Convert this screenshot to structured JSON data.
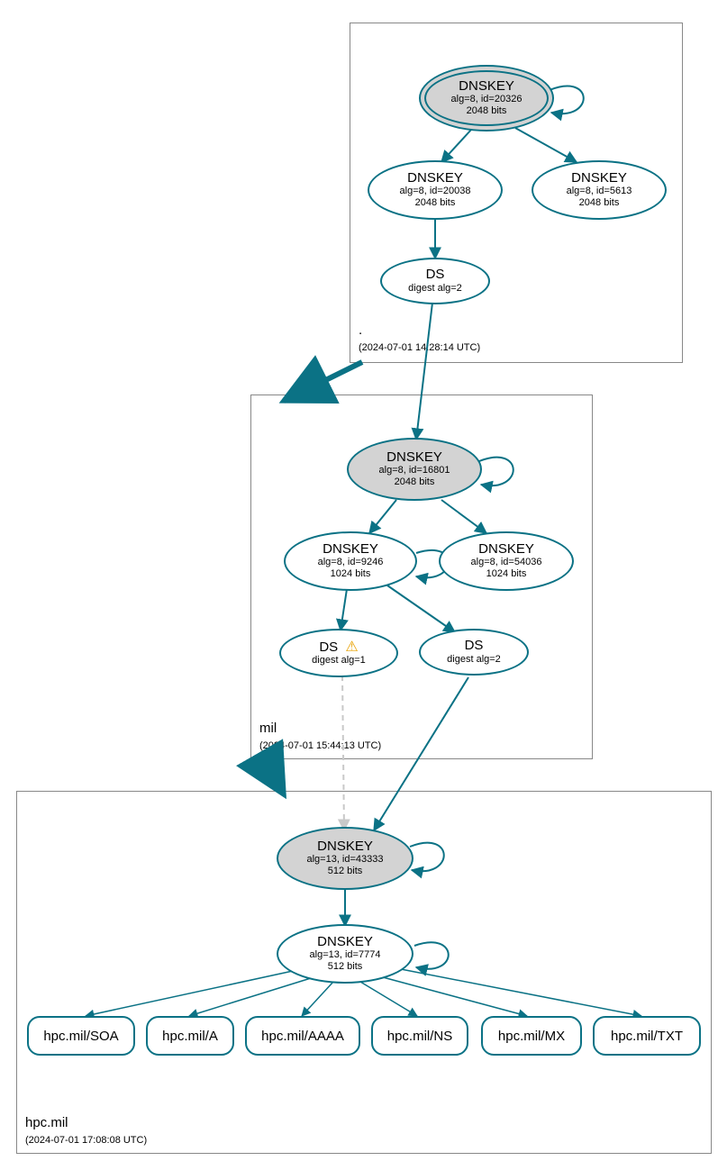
{
  "diagram_type": "DNSSEC delegation / chain of trust",
  "colors": {
    "stroke": "#0b7285",
    "ksk_fill": "#d3d3d3",
    "warn": "#e8a100"
  },
  "zones": {
    "root": {
      "name": ".",
      "timestamp": "(2024-07-01 14:28:14 UTC)"
    },
    "mil": {
      "name": "mil",
      "timestamp": "(2024-07-01 15:44:13 UTC)"
    },
    "hpcmil": {
      "name": "hpc.mil",
      "timestamp": "(2024-07-01 17:08:08 UTC)"
    }
  },
  "nodes": {
    "root_ksk": {
      "title": "DNSKEY",
      "line1": "alg=8, id=20326",
      "line2": "2048 bits"
    },
    "root_zsk1": {
      "title": "DNSKEY",
      "line1": "alg=8, id=20038",
      "line2": "2048 bits"
    },
    "root_zsk2": {
      "title": "DNSKEY",
      "line1": "alg=8, id=5613",
      "line2": "2048 bits"
    },
    "root_ds": {
      "title": "DS",
      "line1": "digest alg=2"
    },
    "mil_ksk": {
      "title": "DNSKEY",
      "line1": "alg=8, id=16801",
      "line2": "2048 bits"
    },
    "mil_zsk1": {
      "title": "DNSKEY",
      "line1": "alg=8, id=9246",
      "line2": "1024 bits"
    },
    "mil_zsk2": {
      "title": "DNSKEY",
      "line1": "alg=8, id=54036",
      "line2": "1024 bits"
    },
    "mil_ds1": {
      "title": "DS",
      "line1": "digest alg=1",
      "warn": true
    },
    "mil_ds2": {
      "title": "DS",
      "line1": "digest alg=2"
    },
    "hpc_ksk": {
      "title": "DNSKEY",
      "line1": "alg=13, id=43333",
      "line2": "512 bits"
    },
    "hpc_zsk": {
      "title": "DNSKEY",
      "line1": "alg=13, id=7774",
      "line2": "512 bits"
    }
  },
  "rrsets": {
    "soa": {
      "label": "hpc.mil/SOA"
    },
    "a": {
      "label": "hpc.mil/A"
    },
    "aaaa": {
      "label": "hpc.mil/AAAA"
    },
    "ns": {
      "label": "hpc.mil/NS"
    },
    "mx": {
      "label": "hpc.mil/MX"
    },
    "txt": {
      "label": "hpc.mil/TXT"
    }
  },
  "chart_data": {
    "type": "graph",
    "description": "DNSSEC authentication chain from root zone through mil to hpc.mil",
    "zones": [
      {
        "name": ".",
        "timestamp_utc": "2024-07-01 14:28:14"
      },
      {
        "name": "mil",
        "timestamp_utc": "2024-07-01 15:44:13"
      },
      {
        "name": "hpc.mil",
        "timestamp_utc": "2024-07-01 17:08:08"
      }
    ],
    "nodes": [
      {
        "id": "root_ksk",
        "zone": ".",
        "type": "DNSKEY",
        "alg": 8,
        "keyid": 20326,
        "bits": 2048,
        "role": "KSK",
        "trust_anchor": true
      },
      {
        "id": "root_zsk1",
        "zone": ".",
        "type": "DNSKEY",
        "alg": 8,
        "keyid": 20038,
        "bits": 2048,
        "role": "ZSK"
      },
      {
        "id": "root_zsk2",
        "zone": ".",
        "type": "DNSKEY",
        "alg": 8,
        "keyid": 5613,
        "bits": 2048,
        "role": "ZSK"
      },
      {
        "id": "root_ds",
        "zone": ".",
        "type": "DS",
        "digest_alg": 2,
        "target_zone": "mil"
      },
      {
        "id": "mil_ksk",
        "zone": "mil",
        "type": "DNSKEY",
        "alg": 8,
        "keyid": 16801,
        "bits": 2048,
        "role": "KSK"
      },
      {
        "id": "mil_zsk1",
        "zone": "mil",
        "type": "DNSKEY",
        "alg": 8,
        "keyid": 9246,
        "bits": 1024,
        "role": "ZSK"
      },
      {
        "id": "mil_zsk2",
        "zone": "mil",
        "type": "DNSKEY",
        "alg": 8,
        "keyid": 54036,
        "bits": 1024,
        "role": "ZSK"
      },
      {
        "id": "mil_ds1",
        "zone": "mil",
        "type": "DS",
        "digest_alg": 1,
        "target_zone": "hpc.mil",
        "warning": true
      },
      {
        "id": "mil_ds2",
        "zone": "mil",
        "type": "DS",
        "digest_alg": 2,
        "target_zone": "hpc.mil"
      },
      {
        "id": "hpc_ksk",
        "zone": "hpc.mil",
        "type": "DNSKEY",
        "alg": 13,
        "keyid": 43333,
        "bits": 512,
        "role": "KSK"
      },
      {
        "id": "hpc_zsk",
        "zone": "hpc.mil",
        "type": "DNSKEY",
        "alg": 13,
        "keyid": 7774,
        "bits": 512,
        "role": "ZSK"
      },
      {
        "id": "rr_soa",
        "zone": "hpc.mil",
        "type": "RRset",
        "name": "hpc.mil",
        "rrtype": "SOA"
      },
      {
        "id": "rr_a",
        "zone": "hpc.mil",
        "type": "RRset",
        "name": "hpc.mil",
        "rrtype": "A"
      },
      {
        "id": "rr_aaaa",
        "zone": "hpc.mil",
        "type": "RRset",
        "name": "hpc.mil",
        "rrtype": "AAAA"
      },
      {
        "id": "rr_ns",
        "zone": "hpc.mil",
        "type": "RRset",
        "name": "hpc.mil",
        "rrtype": "NS"
      },
      {
        "id": "rr_mx",
        "zone": "hpc.mil",
        "type": "RRset",
        "name": "hpc.mil",
        "rrtype": "MX"
      },
      {
        "id": "rr_txt",
        "zone": "hpc.mil",
        "type": "RRset",
        "name": "hpc.mil",
        "rrtype": "TXT"
      }
    ],
    "edges": [
      {
        "from": "root_ksk",
        "to": "root_ksk",
        "kind": "self-sign"
      },
      {
        "from": "root_ksk",
        "to": "root_zsk1",
        "kind": "signs"
      },
      {
        "from": "root_ksk",
        "to": "root_zsk2",
        "kind": "signs"
      },
      {
        "from": "root_zsk1",
        "to": "root_ds",
        "kind": "signs"
      },
      {
        "from": "root_ds",
        "to": "mil_ksk",
        "kind": "delegates"
      },
      {
        "from": "mil_ksk",
        "to": "mil_ksk",
        "kind": "self-sign"
      },
      {
        "from": "mil_ksk",
        "to": "mil_zsk1",
        "kind": "signs"
      },
      {
        "from": "mil_ksk",
        "to": "mil_zsk2",
        "kind": "signs"
      },
      {
        "from": "mil_zsk1",
        "to": "mil_zsk1",
        "kind": "self-sign"
      },
      {
        "from": "mil_zsk1",
        "to": "mil_ds1",
        "kind": "signs"
      },
      {
        "from": "mil_zsk1",
        "to": "mil_ds2",
        "kind": "signs"
      },
      {
        "from": "mil_ds1",
        "to": "hpc_ksk",
        "kind": "delegates",
        "status": "insecure",
        "dashed": true
      },
      {
        "from": "mil_ds2",
        "to": "hpc_ksk",
        "kind": "delegates"
      },
      {
        "from": "hpc_ksk",
        "to": "hpc_ksk",
        "kind": "self-sign"
      },
      {
        "from": "hpc_ksk",
        "to": "hpc_zsk",
        "kind": "signs"
      },
      {
        "from": "hpc_zsk",
        "to": "hpc_zsk",
        "kind": "self-sign"
      },
      {
        "from": "hpc_zsk",
        "to": "rr_soa",
        "kind": "signs"
      },
      {
        "from": "hpc_zsk",
        "to": "rr_a",
        "kind": "signs"
      },
      {
        "from": "hpc_zsk",
        "to": "rr_aaaa",
        "kind": "signs"
      },
      {
        "from": "hpc_zsk",
        "to": "rr_ns",
        "kind": "signs"
      },
      {
        "from": "hpc_zsk",
        "to": "rr_mx",
        "kind": "signs"
      },
      {
        "from": "hpc_zsk",
        "to": "rr_txt",
        "kind": "signs"
      }
    ],
    "zone_delegation_arrows": [
      {
        "from_zone": ".",
        "to_zone": "mil"
      },
      {
        "from_zone": "mil",
        "to_zone": "hpc.mil"
      }
    ]
  }
}
